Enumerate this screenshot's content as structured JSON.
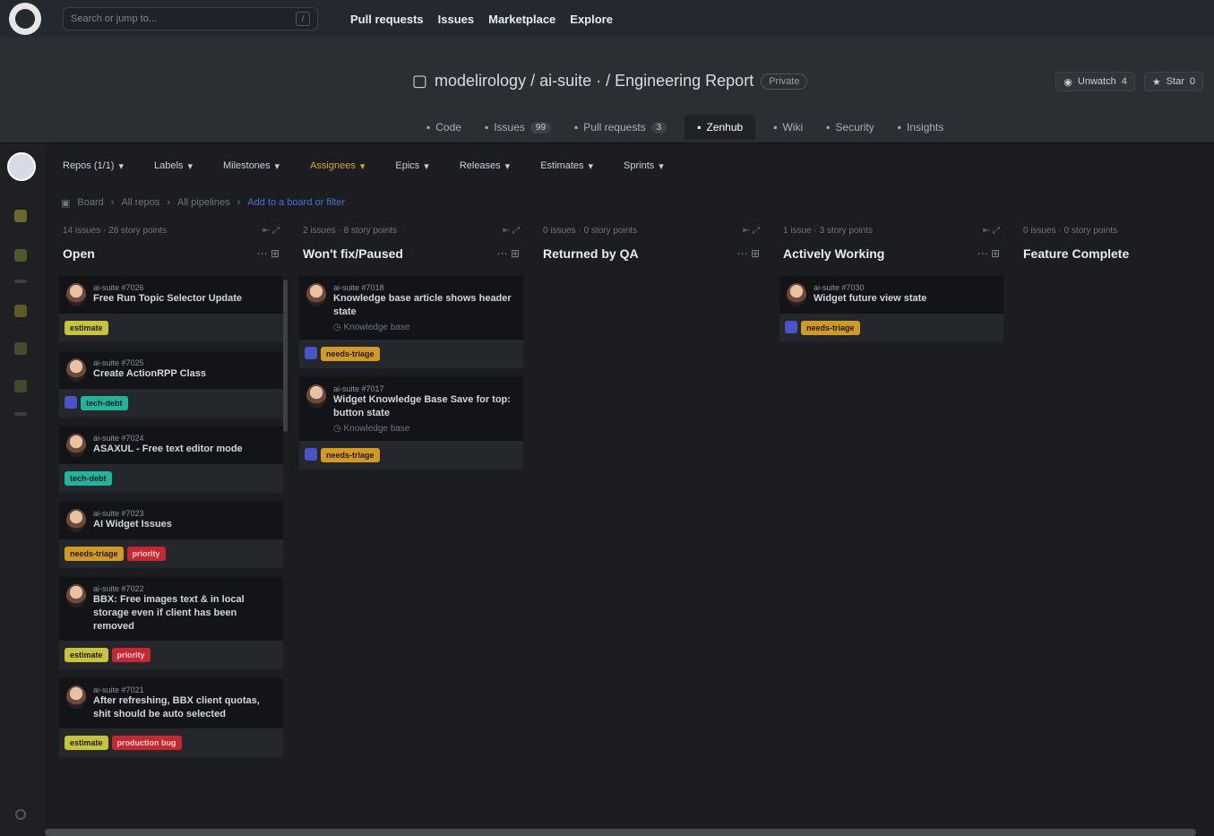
{
  "topbar": {
    "search_placeholder": "Search or jump to...",
    "slash_key": "/",
    "nav": [
      "Pull requests",
      "Issues",
      "Marketplace",
      "Explore"
    ]
  },
  "repo": {
    "title": "modelirology / ai-suite  ·  / Engineering Report",
    "tag": "Private",
    "actions": [
      {
        "icon": "eye-icon",
        "label": "Unwatch",
        "count": "4"
      },
      {
        "icon": "star-icon",
        "label": "Star",
        "count": "0"
      }
    ],
    "tabs": [
      {
        "label": "Code",
        "count": ""
      },
      {
        "label": "Issues",
        "count": "99"
      },
      {
        "label": "Pull requests",
        "count": "3"
      },
      {
        "label": "Zenhub",
        "count": "",
        "active": true
      },
      {
        "label": "Wiki",
        "count": ""
      },
      {
        "label": "Security",
        "count": ""
      },
      {
        "label": "Insights",
        "count": ""
      }
    ]
  },
  "filters": [
    {
      "label": "Repos (1/1)",
      "active": false
    },
    {
      "label": "Labels",
      "active": false
    },
    {
      "label": "Milestones",
      "active": false
    },
    {
      "label": "Assignees",
      "active": true
    },
    {
      "label": "Epics",
      "active": false
    },
    {
      "label": "Releases",
      "active": false
    },
    {
      "label": "Estimates",
      "active": false
    },
    {
      "label": "Sprints",
      "active": false
    }
  ],
  "breadcrumb": {
    "items": [
      "Board",
      "All repos",
      "All pipelines"
    ],
    "current": "Add to a board or filter"
  },
  "columns": [
    {
      "meta": "14 issues · 28 story points",
      "title": "Open",
      "cards": [
        {
          "id": "ai-suite #7026",
          "title": "Free Run Topic Selector Update",
          "labels": [
            {
              "text": "estimate",
              "color": "yellow"
            }
          ],
          "chip": false
        },
        {
          "id": "ai-suite #7025",
          "title": "Create ActionRPP Class",
          "labels": [
            {
              "text": "tech-debt",
              "color": "teal"
            }
          ],
          "chip": true
        },
        {
          "id": "ai-suite #7024",
          "title": "ASAXUL - Free text editor mode",
          "labels": [
            {
              "text": "tech-debt",
              "color": "teal"
            }
          ],
          "chip": false
        },
        {
          "id": "ai-suite #7023",
          "title": "AI Widget Issues",
          "labels": [
            {
              "text": "needs-triage",
              "color": "orange"
            },
            {
              "text": "priority",
              "color": "red"
            }
          ],
          "chip": false
        },
        {
          "id": "ai-suite #7022",
          "title": "BBX: Free images text & in local storage even if client has been removed",
          "labels": [
            {
              "text": "estimate",
              "color": "yellow"
            },
            {
              "text": "priority",
              "color": "red"
            }
          ],
          "chip": false
        },
        {
          "id": "ai-suite #7021",
          "title": "After refreshing, BBX client quotas, shit should be auto selected",
          "labels": [
            {
              "text": "estimate",
              "color": "yellow"
            },
            {
              "text": "production bug",
              "color": "red"
            }
          ],
          "chip": false
        }
      ]
    },
    {
      "meta": "2 issues · 8 story points",
      "title": "Won't fix/Paused",
      "cards": [
        {
          "id": "ai-suite #7018",
          "title": "Knowledge base article shows header state",
          "sub": "Knowledge base",
          "labels": [
            {
              "text": "needs-triage",
              "color": "orange"
            }
          ],
          "chip": true
        },
        {
          "id": "ai-suite #7017",
          "title": "Widget Knowledge Base Save for top: button state",
          "sub": "Knowledge base",
          "labels": [
            {
              "text": "needs-triage",
              "color": "orange"
            }
          ],
          "chip": true
        }
      ]
    },
    {
      "meta": "0 issues · 0 story points",
      "title": "Returned by QA",
      "cards": []
    },
    {
      "meta": "1 issue · 3 story points",
      "title": "Actively Working",
      "cards": [
        {
          "id": "ai-suite #7030",
          "title": "Widget future view state",
          "labels": [
            {
              "text": "needs-triage",
              "color": "orange"
            }
          ],
          "chip": true
        }
      ]
    },
    {
      "meta": "0 issues · 0 story points",
      "title": "Feature Complete",
      "cards": []
    }
  ]
}
